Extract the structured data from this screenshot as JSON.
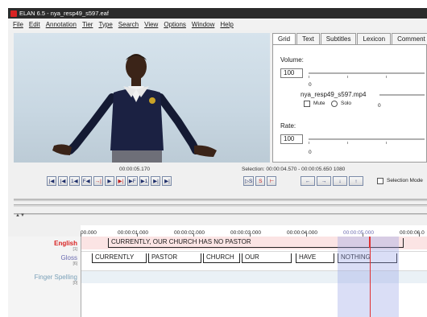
{
  "window": {
    "title": "ELAN 6.5 - nya_resp49_s597.eaf"
  },
  "menu": [
    {
      "label": "File"
    },
    {
      "label": "Edit"
    },
    {
      "label": "Annotation"
    },
    {
      "label": "Tier"
    },
    {
      "label": "Type"
    },
    {
      "label": "Search"
    },
    {
      "label": "View"
    },
    {
      "label": "Options"
    },
    {
      "label": "Window"
    },
    {
      "label": "Help"
    }
  ],
  "tabs": [
    {
      "label": "Grid"
    },
    {
      "label": "Text"
    },
    {
      "label": "Subtitles"
    },
    {
      "label": "Lexicon"
    },
    {
      "label": "Comment"
    }
  ],
  "audio_panel": {
    "volume_label": "Volume:",
    "volume_value": "100",
    "volume_min": "0",
    "media_file": "nya_resp49_s597.mp4",
    "mute_label": "Mute",
    "solo_label": "Solo",
    "media_min": "0",
    "rate_label": "Rate:",
    "rate_value": "100",
    "rate_min": "0"
  },
  "player": {
    "time": "00:00:05.170",
    "selection": "Selection: 00:00:04.570 - 00:00:05.650  1080",
    "selection_mode": "Selection Mode",
    "buttons": [
      "|◀",
      "|◀",
      "1◀",
      "F◀",
      "→|",
      "▶",
      "▶|",
      "▶F",
      "▶1",
      "▶|",
      "▶|"
    ],
    "sel_buttons": [
      "▷S",
      "S",
      "⊢"
    ],
    "nav_buttons": [
      "←",
      "→",
      "↓",
      "↑"
    ]
  },
  "ruler": {
    "labels": [
      "00.000",
      "00:00:01.000",
      "00:00:02.000",
      "00:00:03.000",
      "00:00:04.000",
      "00:00:05.000",
      "00:00:06.0"
    ]
  },
  "tiers": [
    {
      "name": "English",
      "count": "[1]",
      "color": "#d82323"
    },
    {
      "name": "Gloss",
      "count": "[6]",
      "color": "#6b6bb0"
    },
    {
      "name": "Finger Spelling",
      "count": "[0]",
      "color": "#7aa0b8"
    }
  ],
  "annotations": {
    "english": [
      {
        "text": "CURRENTLY, OUR CHURCH HAS NO PASTOR"
      }
    ],
    "gloss": [
      {
        "text": "CURRENTLY"
      },
      {
        "text": "PASTOR"
      },
      {
        "text": "CHURCH"
      },
      {
        "text": "OUR"
      },
      {
        "text": "HAVE"
      },
      {
        "text": "NOTHING"
      }
    ]
  },
  "colors": {
    "accent": "#d82323",
    "selection": "#9aa0e6",
    "crosshair": "#e03030"
  }
}
